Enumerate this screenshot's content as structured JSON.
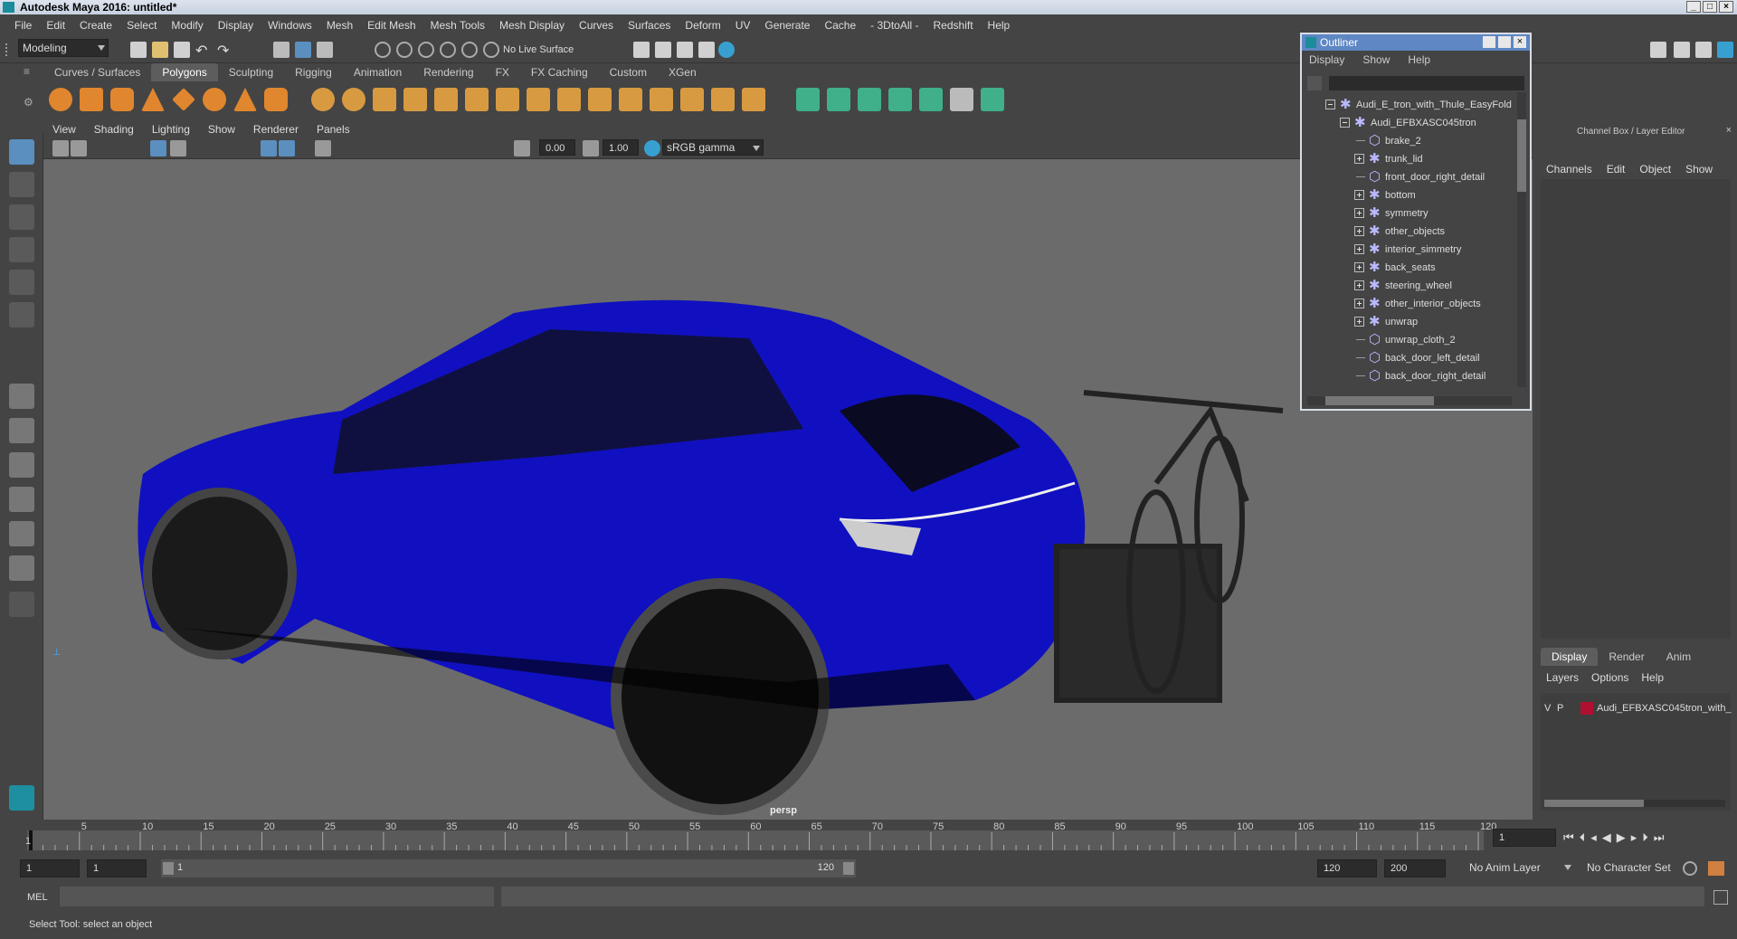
{
  "app": {
    "title": "Autodesk Maya 2016: untitled*"
  },
  "menubar": [
    "File",
    "Edit",
    "Create",
    "Select",
    "Modify",
    "Display",
    "Windows",
    "Mesh",
    "Edit Mesh",
    "Mesh Tools",
    "Mesh Display",
    "Curves",
    "Surfaces",
    "Deform",
    "UV",
    "Generate",
    "Cache",
    "- 3DtoAll -",
    "Redshift",
    "Help"
  ],
  "status": {
    "mode": "Modeling",
    "live_surface": "No Live Surface"
  },
  "shelf": {
    "tabs": [
      "Curves / Surfaces",
      "Polygons",
      "Sculpting",
      "Rigging",
      "Animation",
      "Rendering",
      "FX",
      "FX Caching",
      "Custom",
      "XGen"
    ],
    "active": "Polygons"
  },
  "viewport": {
    "menus": [
      "View",
      "Shading",
      "Lighting",
      "Show",
      "Renderer",
      "Panels"
    ],
    "exposure": "0.00",
    "gamma": "1.00",
    "colorspace": "sRGB gamma",
    "camera": "persp"
  },
  "outliner": {
    "title": "Outliner",
    "menus": [
      "Display",
      "Show",
      "Help"
    ],
    "items": [
      {
        "label": "Audi_E_tron_with_Thule_EasyFold",
        "level": 0,
        "expand": "minus"
      },
      {
        "label": "Audi_EFBXASC045tron",
        "level": 1,
        "expand": "minus"
      },
      {
        "label": "brake_2",
        "level": 2,
        "expand": "none"
      },
      {
        "label": "trunk_lid",
        "level": 2,
        "expand": "plus"
      },
      {
        "label": "front_door_right_detail",
        "level": 2,
        "expand": "none"
      },
      {
        "label": "bottom",
        "level": 2,
        "expand": "plus"
      },
      {
        "label": "symmetry",
        "level": 2,
        "expand": "plus"
      },
      {
        "label": "other_objects",
        "level": 2,
        "expand": "plus"
      },
      {
        "label": "interior_simmetry",
        "level": 2,
        "expand": "plus"
      },
      {
        "label": "back_seats",
        "level": 2,
        "expand": "plus"
      },
      {
        "label": "steering_wheel",
        "level": 2,
        "expand": "plus"
      },
      {
        "label": "other_interior_objects",
        "level": 2,
        "expand": "plus"
      },
      {
        "label": "unwrap",
        "level": 2,
        "expand": "plus"
      },
      {
        "label": "unwrap_cloth_2",
        "level": 2,
        "expand": "none"
      },
      {
        "label": "back_door_left_detail",
        "level": 2,
        "expand": "none"
      },
      {
        "label": "back_door_right_detail",
        "level": 2,
        "expand": "none"
      }
    ]
  },
  "channelbox": {
    "title": "Channel Box / Layer Editor",
    "menus": [
      "Channels",
      "Edit",
      "Object",
      "Show"
    ],
    "layer_tabs": [
      "Display",
      "Render",
      "Anim"
    ],
    "layer_menus": [
      "Layers",
      "Options",
      "Help"
    ],
    "layer": {
      "v": "V",
      "p": "P",
      "name": "Audi_EFBXASC045tron_with_"
    }
  },
  "timeline": {
    "ticks": [
      "5",
      "10",
      "15",
      "20",
      "25",
      "30",
      "35",
      "40",
      "45",
      "50",
      "55",
      "60",
      "65",
      "70",
      "75",
      "80",
      "85",
      "90",
      "95",
      "100",
      "105",
      "110",
      "115",
      "120"
    ],
    "start_marker": "1",
    "current_frame": "1"
  },
  "range": {
    "start": "1",
    "start2": "1",
    "slider_start": "1",
    "slider_end": "120",
    "end": "120",
    "end2": "200",
    "anim_layer": "No Anim Layer",
    "char_set": "No Character Set"
  },
  "cmd": {
    "label": "MEL"
  },
  "help": {
    "text": "Select Tool: select an object"
  }
}
